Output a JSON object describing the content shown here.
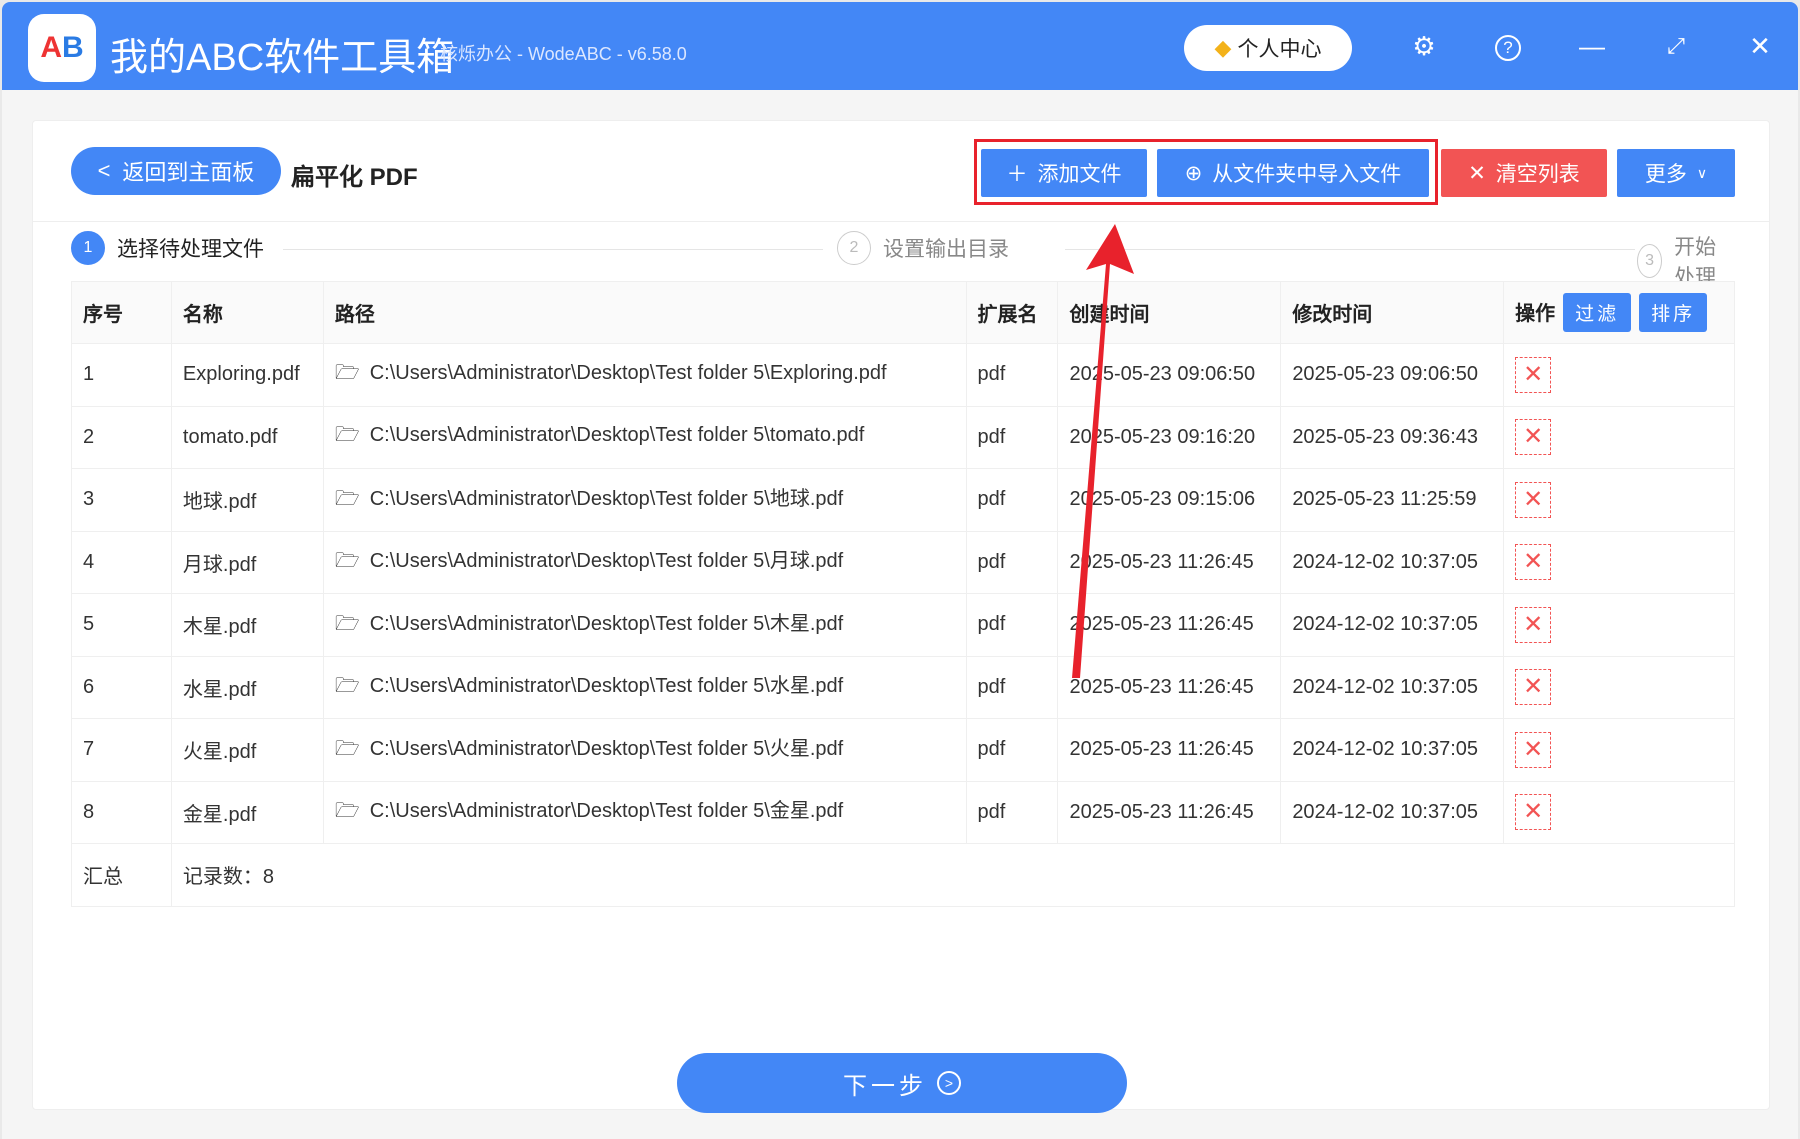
{
  "app": {
    "title": "我的ABC软件工具箱",
    "subtitle": "核烁办公 - WodeABC - v6.58.0",
    "user_center": "个人中心",
    "logo": "AB"
  },
  "toolbar": {
    "back": "返回到主面板",
    "page_title": "扁平化 PDF",
    "add_file": "添加文件",
    "import_folder": "从文件夹中导入文件",
    "clear_list": "清空列表",
    "more": "更多"
  },
  "steps": [
    {
      "num": "1",
      "label": "选择待处理文件"
    },
    {
      "num": "2",
      "label": "设置输出目录"
    },
    {
      "num": "3",
      "label": "开始处理"
    }
  ],
  "table": {
    "headers": [
      "序号",
      "名称",
      "路径",
      "扩展名",
      "创建时间",
      "修改时间",
      "操作"
    ],
    "filter": "过滤",
    "sort": "排序",
    "rows": [
      {
        "no": "1",
        "name": "Exploring.pdf",
        "path": "C:\\Users\\Administrator\\Desktop\\Test folder 5\\Exploring.pdf",
        "ext": "pdf",
        "created": "2025-05-23 09:06:50",
        "modified": "2025-05-23 09:06:50"
      },
      {
        "no": "2",
        "name": "tomato.pdf",
        "path": "C:\\Users\\Administrator\\Desktop\\Test folder 5\\tomato.pdf",
        "ext": "pdf",
        "created": "2025-05-23 09:16:20",
        "modified": "2025-05-23 09:36:43"
      },
      {
        "no": "3",
        "name": "地球.pdf",
        "path": "C:\\Users\\Administrator\\Desktop\\Test folder 5\\地球.pdf",
        "ext": "pdf",
        "created": "2025-05-23 09:15:06",
        "modified": "2025-05-23 11:25:59"
      },
      {
        "no": "4",
        "name": "月球.pdf",
        "path": "C:\\Users\\Administrator\\Desktop\\Test folder 5\\月球.pdf",
        "ext": "pdf",
        "created": "2025-05-23 11:26:45",
        "modified": "2024-12-02 10:37:05"
      },
      {
        "no": "5",
        "name": "木星.pdf",
        "path": "C:\\Users\\Administrator\\Desktop\\Test folder 5\\木星.pdf",
        "ext": "pdf",
        "created": "2025-05-23 11:26:45",
        "modified": "2024-12-02 10:37:05"
      },
      {
        "no": "6",
        "name": "水星.pdf",
        "path": "C:\\Users\\Administrator\\Desktop\\Test folder 5\\水星.pdf",
        "ext": "pdf",
        "created": "2025-05-23 11:26:45",
        "modified": "2024-12-02 10:37:05"
      },
      {
        "no": "7",
        "name": "火星.pdf",
        "path": "C:\\Users\\Administrator\\Desktop\\Test folder 5\\火星.pdf",
        "ext": "pdf",
        "created": "2025-05-23 11:26:45",
        "modified": "2024-12-02 10:37:05"
      },
      {
        "no": "8",
        "name": "金星.pdf",
        "path": "C:\\Users\\Administrator\\Desktop\\Test folder 5\\金星.pdf",
        "ext": "pdf",
        "created": "2025-05-23 11:26:45",
        "modified": "2024-12-02 10:37:05"
      }
    ],
    "summary_label": "汇总",
    "summary_count": "记录数：8"
  },
  "next": "下一步",
  "colors": {
    "accent": "#4387f6",
    "danger": "#f25454",
    "highlight": "#e8222c"
  }
}
